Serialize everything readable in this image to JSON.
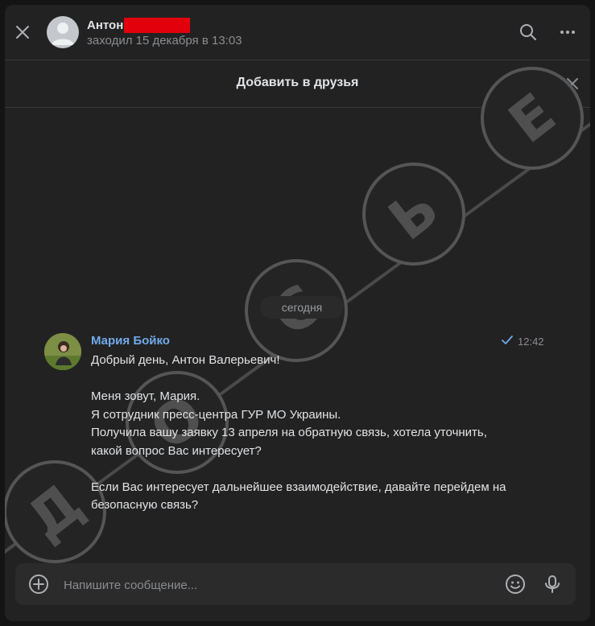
{
  "header": {
    "contact_name": "Антон",
    "last_seen": "заходил 15 декабря в 13:03"
  },
  "add_friend_bar": {
    "label": "Добавить в друзья"
  },
  "watermark": {
    "letters": [
      "Д",
      "О",
      "С",
      "Ь",
      "Е"
    ]
  },
  "chat": {
    "date_separator": "сегодня",
    "message": {
      "sender": "Мария Бойко",
      "time": "12:42",
      "status_icon": "check-icon",
      "text": "Добрый день, Антон Валерьевич!\n\nМеня зовут, Мария.\nЯ сотрудник пресс-центра ГУР МО Украины.\nПолучила вашу заявку 13 апреля на обратную связь, хотела уточнить, какой вопрос Вас интересует?\n\nЕсли Вас интересует дальнейшее взаимодействие, давайте перейдем на безопасную связь?"
    }
  },
  "composer": {
    "placeholder": "Напишите сообщение...",
    "value": ""
  },
  "icons": {
    "close": "close-icon",
    "search": "search-icon",
    "more": "more-icon",
    "attach": "plus-circle-icon",
    "emoji": "smile-icon",
    "voice": "microphone-icon"
  },
  "colors": {
    "background": "#222222",
    "accent_link": "#71aaeb",
    "redaction": "#e3000d"
  }
}
